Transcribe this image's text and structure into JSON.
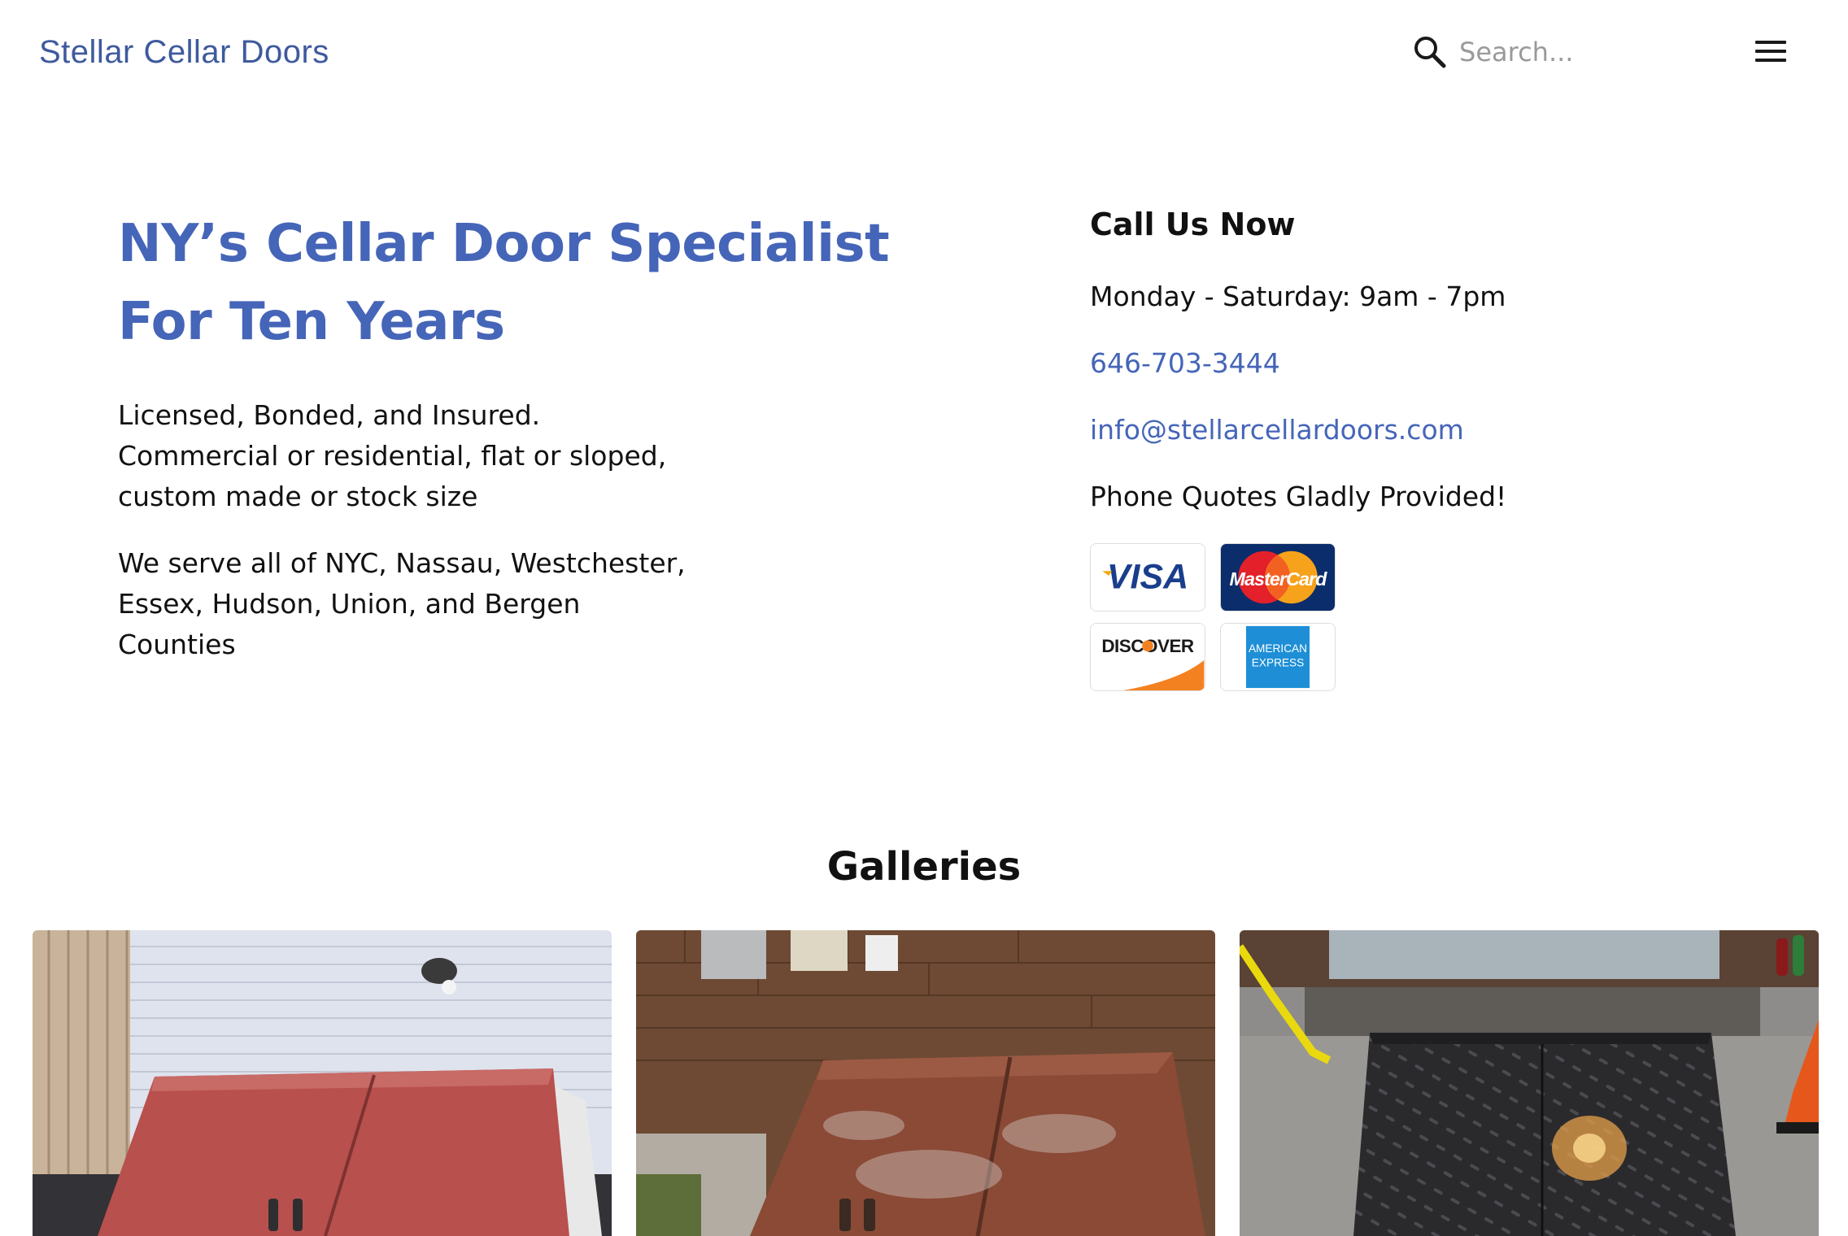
{
  "header": {
    "site_title": "Stellar Cellar Doors",
    "search": {
      "placeholder": "Search...",
      "value": ""
    },
    "menu_icon": "hamburger-menu-icon",
    "search_icon": "search-icon"
  },
  "hero": {
    "heading_line1": "NY’s Cellar Door Specialist",
    "heading_line2": "For Ten Years",
    "para1_line1": "Licensed, Bonded, and Insured.",
    "para1_line2": "Commercial or residential, flat or sloped,",
    "para1_line3": "custom made or stock size",
    "para2_line1": "We serve all of NYC, Nassau, Westchester,",
    "para2_line2": "Essex, Hudson, Union, and Bergen",
    "para2_line3": "Counties"
  },
  "contact": {
    "heading": "Call Us Now",
    "hours": "Monday - Saturday: 9am - 7pm",
    "phone": "646-703-3444",
    "email": "info@stellarcellardoors.com",
    "quotes": "Phone Quotes Gladly Provided!",
    "payment_cards": {
      "visa": "VISA",
      "mastercard": "MasterCard",
      "discover": "DISCOVER",
      "amex_line1": "AMERICAN",
      "amex_line2": "EXPRESS"
    }
  },
  "galleries": {
    "title": "Galleries"
  },
  "colors": {
    "brand_blue": "#4565b8",
    "title_blue": "#3e5a9e",
    "text": "#111111"
  }
}
